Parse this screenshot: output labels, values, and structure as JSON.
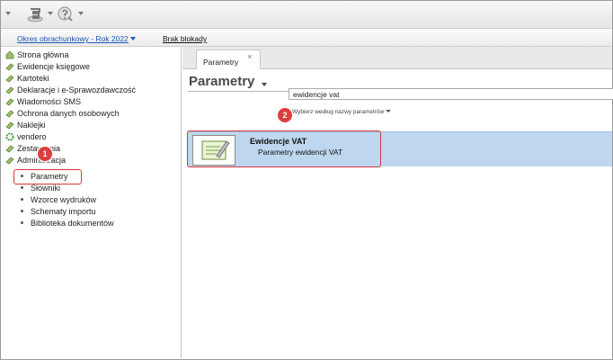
{
  "toolbar": {
    "icons": [
      "accounting-module-icon",
      "help-icon"
    ]
  },
  "period_bar": {
    "period_label": "Okres obrachunkowy - Rok 2022",
    "lock_label": "Brak blokady"
  },
  "sidebar": {
    "items": [
      {
        "label": "Strona główna",
        "icon": "home-icon"
      },
      {
        "label": "Ewidencje księgowe",
        "icon": "ledger-icon"
      },
      {
        "label": "Kartoteki",
        "icon": "files-icon"
      },
      {
        "label": "Deklaracje i e-Sprawozdawczość",
        "icon": "declarations-icon"
      },
      {
        "label": "Wiadomości SMS",
        "icon": "sms-icon"
      },
      {
        "label": "Ochrona danych osobowych",
        "icon": "shield-icon"
      },
      {
        "label": "Naklejki",
        "icon": "sticker-icon"
      },
      {
        "label": "vendero",
        "icon": "vendero-icon"
      },
      {
        "label": "Zestawienia",
        "icon": "reports-icon"
      },
      {
        "label": "Administracja",
        "icon": "admin-icon"
      }
    ],
    "sub_items": [
      {
        "label": "Parametry"
      },
      {
        "label": "Słowniki"
      },
      {
        "label": "Wzorce wydruków"
      },
      {
        "label": "Schematy importu"
      },
      {
        "label": "Biblioteka dokumentów"
      }
    ]
  },
  "badges": {
    "step1": "1",
    "step2": "2"
  },
  "tabs": [
    {
      "label": "Parametry",
      "close": "×"
    }
  ],
  "main": {
    "title": "Parametry",
    "search_value": "ewidencje vat",
    "filter_label": "Wybierz według nazwy parametrów"
  },
  "results": [
    {
      "title": "Ewidencje VAT",
      "subtitle": "Parametry ewidencji VAT",
      "icon": "edit-document-icon"
    }
  ],
  "colors": {
    "accent_red": "#d9363e",
    "selection": "#bed7ef",
    "link": "#1a57b7"
  }
}
